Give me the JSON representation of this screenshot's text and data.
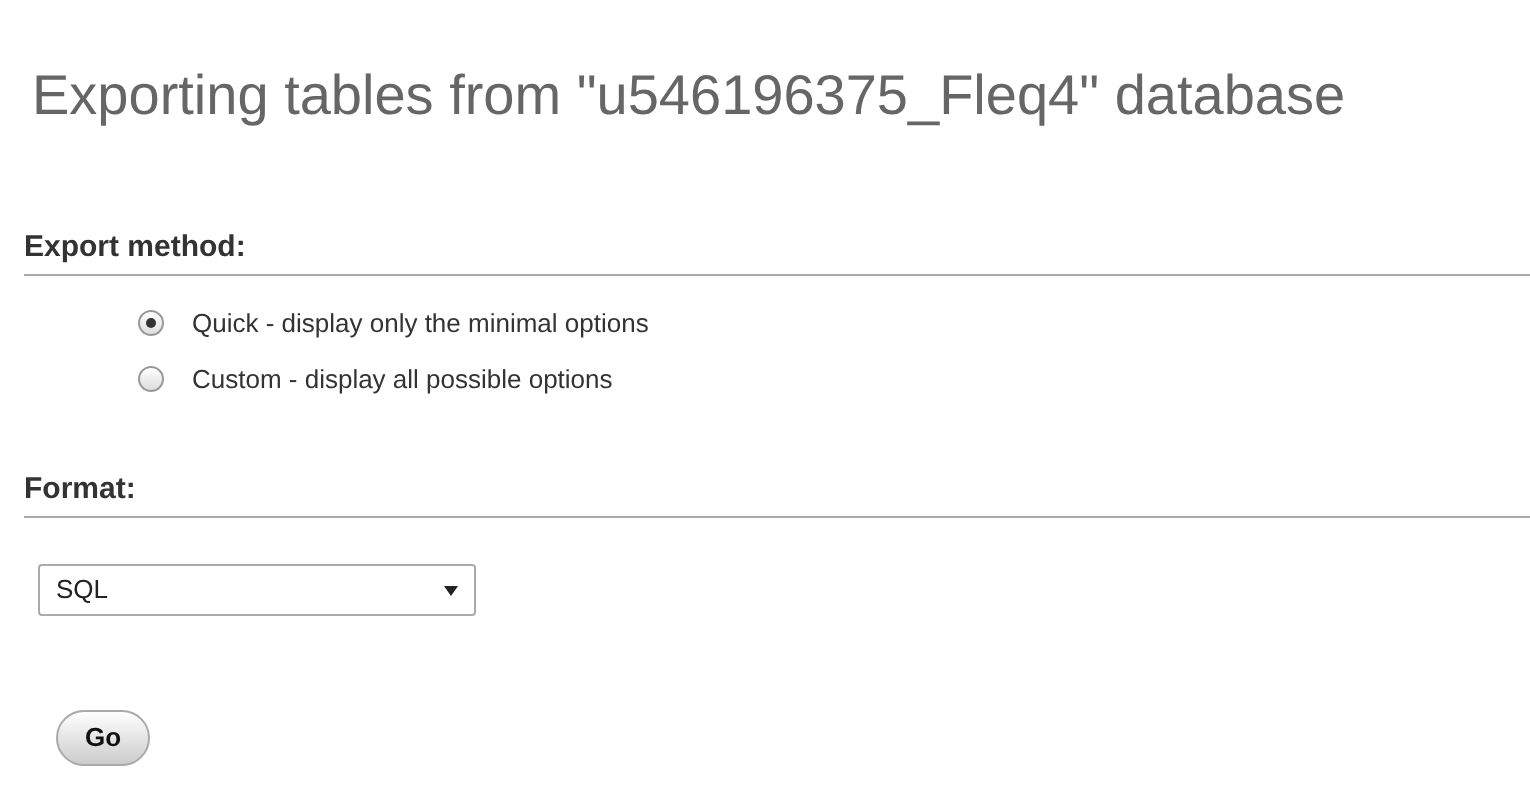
{
  "title": "Exporting tables from \"u546196375_Fleq4\" database",
  "export_method": {
    "heading": "Export method:",
    "options": [
      {
        "label": "Quick - display only the minimal options",
        "selected": true
      },
      {
        "label": "Custom - display all possible options",
        "selected": false
      }
    ]
  },
  "format": {
    "heading": "Format:",
    "value": "SQL"
  },
  "buttons": [
    "Go"
  ]
}
